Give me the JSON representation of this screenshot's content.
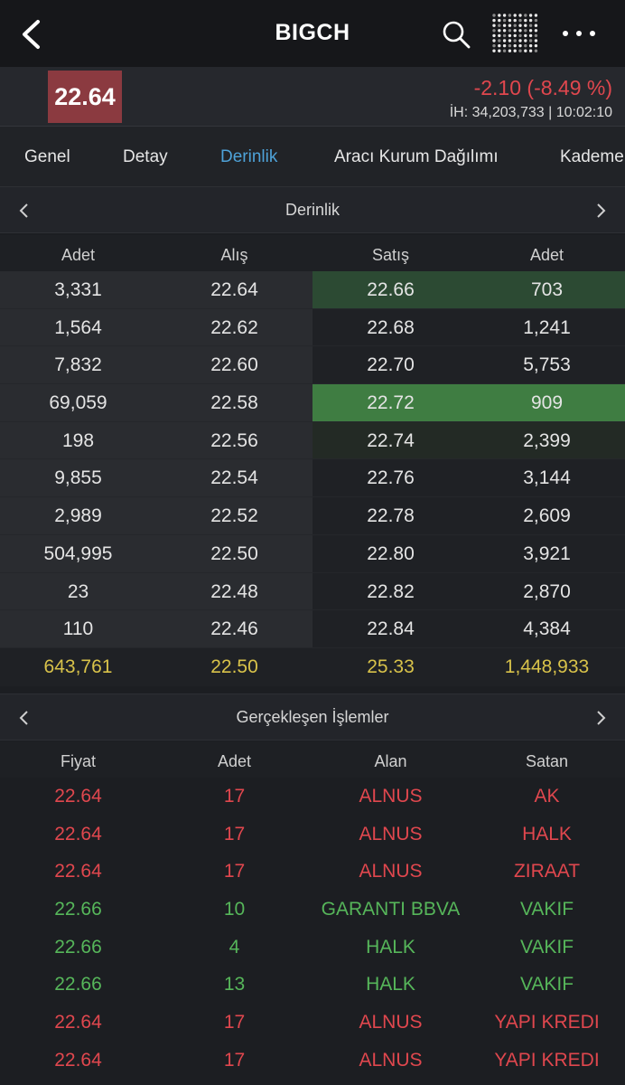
{
  "header": {
    "title": "BIGCH"
  },
  "quote": {
    "last_price": "22.64",
    "change": "-2.10 (-8.49 %)",
    "volume_line": "İH:  34,203,733 | 10:02:10",
    "price_box_color": "#8b3a40",
    "change_color": "#e0474e"
  },
  "tabs": [
    {
      "label": "Genel",
      "active": false
    },
    {
      "label": "Detay",
      "active": false
    },
    {
      "label": "Derinlik",
      "active": true
    },
    {
      "label": "Aracı Kurum Dağılımı",
      "active": false
    },
    {
      "label": "Kademe",
      "active": false
    }
  ],
  "depth": {
    "section_title": "Derinlik",
    "columns": [
      "Adet",
      "Alış",
      "Satış",
      "Adet"
    ],
    "rows": [
      {
        "bid_qty": "3,331",
        "bid": "22.64",
        "ask": "22.66",
        "ask_qty": "703",
        "hl": "dark"
      },
      {
        "bid_qty": "1,564",
        "bid": "22.62",
        "ask": "22.68",
        "ask_qty": "1,241",
        "hl": ""
      },
      {
        "bid_qty": "7,832",
        "bid": "22.60",
        "ask": "22.70",
        "ask_qty": "5,753",
        "hl": ""
      },
      {
        "bid_qty": "69,059",
        "bid": "22.58",
        "ask": "22.72",
        "ask_qty": "909",
        "hl": "bright"
      },
      {
        "bid_qty": "198",
        "bid": "22.56",
        "ask": "22.74",
        "ask_qty": "2,399",
        "hl": "faint"
      },
      {
        "bid_qty": "9,855",
        "bid": "22.54",
        "ask": "22.76",
        "ask_qty": "3,144",
        "hl": ""
      },
      {
        "bid_qty": "2,989",
        "bid": "22.52",
        "ask": "22.78",
        "ask_qty": "2,609",
        "hl": ""
      },
      {
        "bid_qty": "504,995",
        "bid": "22.50",
        "ask": "22.80",
        "ask_qty": "3,921",
        "hl": ""
      },
      {
        "bid_qty": "23",
        "bid": "22.48",
        "ask": "22.82",
        "ask_qty": "2,870",
        "hl": ""
      },
      {
        "bid_qty": "110",
        "bid": "22.46",
        "ask": "22.84",
        "ask_qty": "4,384",
        "hl": ""
      }
    ],
    "totals": {
      "bid_qty": "643,761",
      "bid": "22.50",
      "ask": "25.33",
      "ask_qty": "1,448,933"
    },
    "total_color": "#d8c24a"
  },
  "trades": {
    "section_title": "Gerçekleşen İşlemler",
    "columns": [
      "Fiyat",
      "Adet",
      "Alan",
      "Satan"
    ],
    "rows": [
      {
        "price": "22.64",
        "qty": "17",
        "buyer": "ALNUS",
        "seller": "AK",
        "dir": "down"
      },
      {
        "price": "22.64",
        "qty": "17",
        "buyer": "ALNUS",
        "seller": "HALK",
        "dir": "down"
      },
      {
        "price": "22.64",
        "qty": "17",
        "buyer": "ALNUS",
        "seller": "ZIRAAT",
        "dir": "down"
      },
      {
        "price": "22.66",
        "qty": "10",
        "buyer": "GARANTI BBVA",
        "seller": "VAKIF",
        "dir": "up"
      },
      {
        "price": "22.66",
        "qty": "4",
        "buyer": "HALK",
        "seller": "VAKIF",
        "dir": "up"
      },
      {
        "price": "22.66",
        "qty": "13",
        "buyer": "HALK",
        "seller": "VAKIF",
        "dir": "up"
      },
      {
        "price": "22.64",
        "qty": "17",
        "buyer": "ALNUS",
        "seller": "YAPI KREDI",
        "dir": "down"
      },
      {
        "price": "22.64",
        "qty": "17",
        "buyer": "ALNUS",
        "seller": "YAPI KREDI",
        "dir": "down"
      }
    ],
    "up_color": "#56b65a",
    "down_color": "#e0474e"
  },
  "icons": {
    "back": "chevron-left-icon",
    "search": "search-icon",
    "grid": "dot-grid-icon",
    "more": "more-horizontal-icon"
  }
}
